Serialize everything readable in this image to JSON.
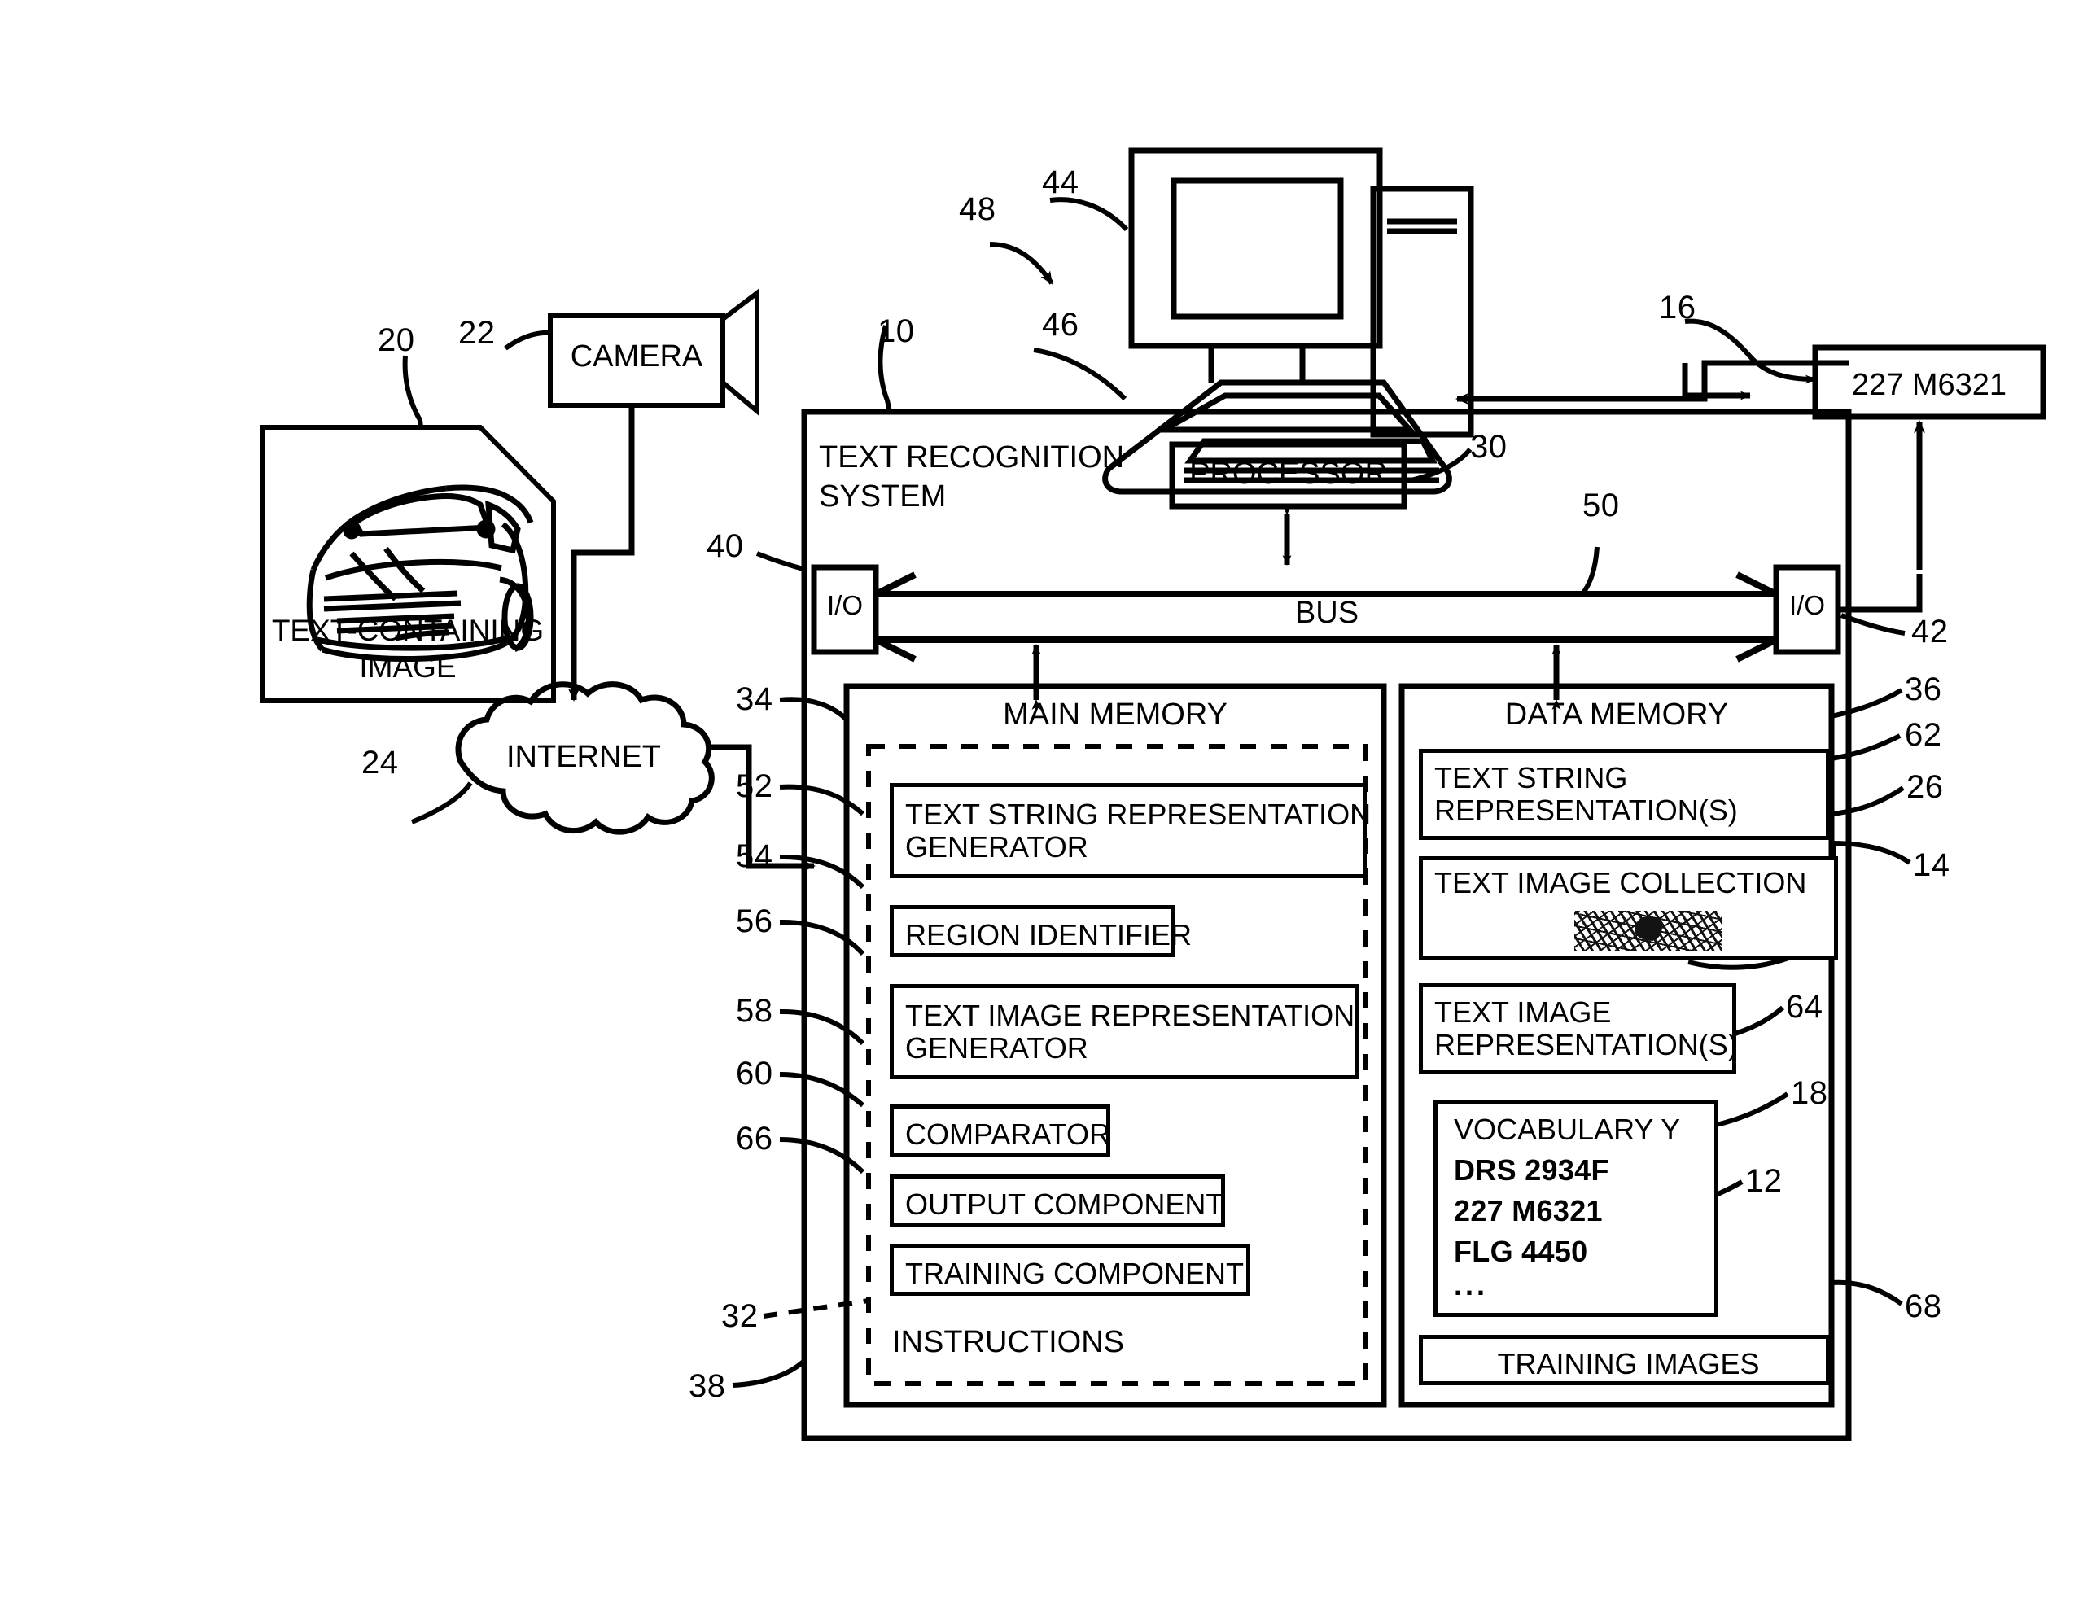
{
  "figure": {
    "title": "Text Recognition System block diagram"
  },
  "nodes": {
    "source_image": {
      "caption_line1": "TEXT-CONTAINING",
      "caption_line2": "IMAGE",
      "ref": "20"
    },
    "camera": {
      "label": "CAMERA",
      "ref": "22"
    },
    "internet": {
      "label": "INTERNET",
      "ref": "24"
    },
    "workstation": {
      "ref_display": "48",
      "monitor_ref": "44",
      "keyboard_ref": "46"
    },
    "output_plate": {
      "label": "227 M6321",
      "ref": "16"
    },
    "system": {
      "title_line1": "TEXT RECOGNITION",
      "title_line2": "SYSTEM",
      "ref": "10"
    },
    "processor": {
      "label": "PROCESSOR",
      "ref": "30"
    },
    "bus": {
      "label": "BUS",
      "ref": "50"
    },
    "io_left": {
      "label": "I/O",
      "ref": "40"
    },
    "io_right": {
      "label": "I/O",
      "ref": "42"
    },
    "main_memory": {
      "label": "MAIN MEMORY",
      "ref": "34"
    },
    "instructions": {
      "label": "INSTRUCTIONS",
      "ref": "32",
      "outer_ref": "38"
    },
    "data_memory": {
      "label": "DATA MEMORY",
      "ref": "36"
    }
  },
  "main_memory_items": [
    {
      "ref": "52",
      "label": "TEXT STRING REPRESENTATION\nGENERATOR",
      "lines": 2
    },
    {
      "ref": "54",
      "label": "REGION IDENTIFIER",
      "lines": 1
    },
    {
      "ref": "56",
      "label": "TEXT IMAGE REPRESENTATION\nGENERATOR",
      "lines": 2
    },
    {
      "ref": "58",
      "label": "COMPARATOR",
      "lines": 1
    },
    {
      "ref": "60",
      "label": "OUTPUT COMPONENT",
      "lines": 1
    },
    {
      "ref": "66",
      "label": "TRAINING COMPONENT",
      "lines": 1
    }
  ],
  "data_memory_items": [
    {
      "ref": "62",
      "label": "TEXT STRING\nREPRESENTATION(S)"
    },
    {
      "ref": "26",
      "label": "TEXT IMAGE COLLECTION",
      "sample_ref": "14",
      "sample_kind": "noisy-text-image"
    },
    {
      "ref": "64",
      "label": "TEXT IMAGE\nREPRESENTATION(S)"
    },
    {
      "ref": "68",
      "label": "TRAINING IMAGES"
    }
  ],
  "vocabulary": {
    "ref": "18",
    "entry_ref": "12",
    "title": "VOCABULARY Y",
    "entries": [
      "DRS 2934F",
      "227 M6321",
      "FLG 4450"
    ],
    "ellipsis": "..."
  },
  "colors": {
    "ink": "#000000",
    "paper": "#ffffff"
  }
}
